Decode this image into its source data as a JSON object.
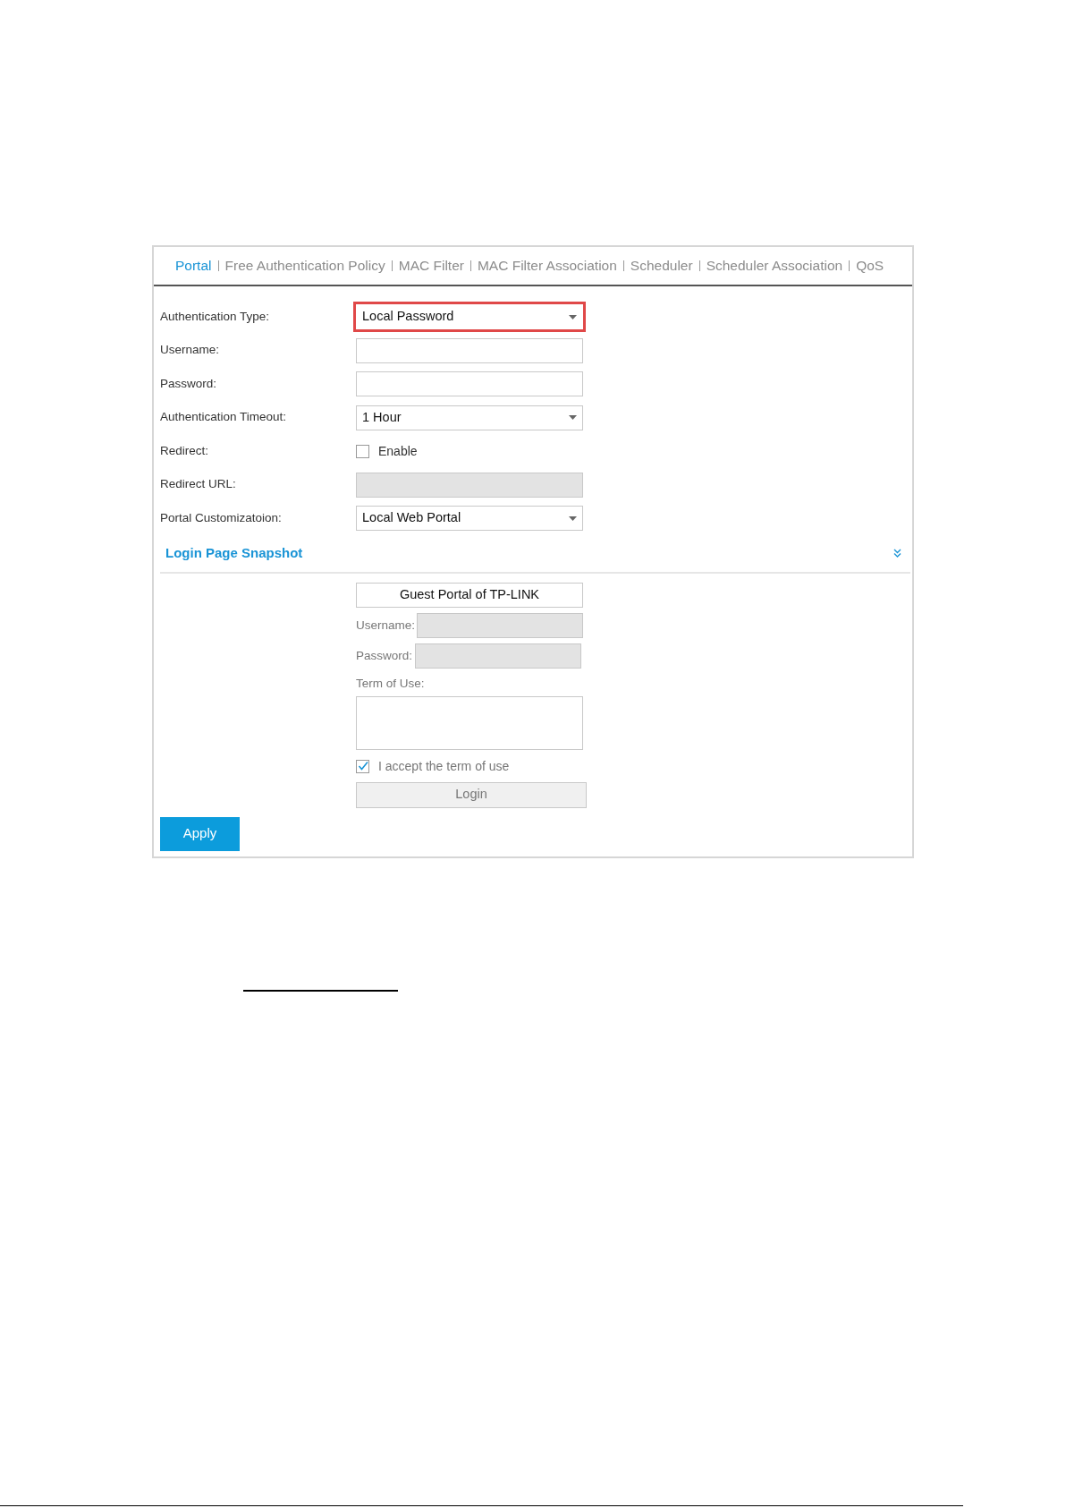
{
  "tabs": [
    {
      "label": "Portal",
      "selected": true
    },
    {
      "label": "Free Authentication Policy",
      "selected": false
    },
    {
      "label": "MAC Filter",
      "selected": false
    },
    {
      "label": "MAC Filter Association",
      "selected": false
    },
    {
      "label": "Scheduler",
      "selected": false
    },
    {
      "label": "Scheduler Association",
      "selected": false
    },
    {
      "label": "QoS",
      "selected": false
    }
  ],
  "fields": [
    {
      "kind": "select",
      "label": "Authentication Type:",
      "value": "Local Password",
      "highlighted": true
    },
    {
      "kind": "text",
      "label": "Username:",
      "disabled": false
    },
    {
      "kind": "text",
      "label": "Password:",
      "disabled": false
    },
    {
      "kind": "select",
      "label": "Authentication Timeout:",
      "value": "1 Hour",
      "highlighted": false
    },
    {
      "kind": "checkbox",
      "label": "Redirect:",
      "option": "Enable",
      "checked": false
    },
    {
      "kind": "text",
      "label": "Redirect URL:",
      "disabled": true
    },
    {
      "kind": "select",
      "label": "Portal Customizatoion:",
      "value": "Local Web Portal",
      "highlighted": false
    }
  ],
  "snapshot": {
    "title": "Login Page Snapshot",
    "portal_title": "Guest Portal of TP-LINK",
    "username_label": "Username:",
    "password_label": "Password:",
    "terms_label": "Term of Use:",
    "accept": {
      "label": "I accept the term of use",
      "checked": true
    },
    "login_button": "Login"
  },
  "apply_button": "Apply"
}
